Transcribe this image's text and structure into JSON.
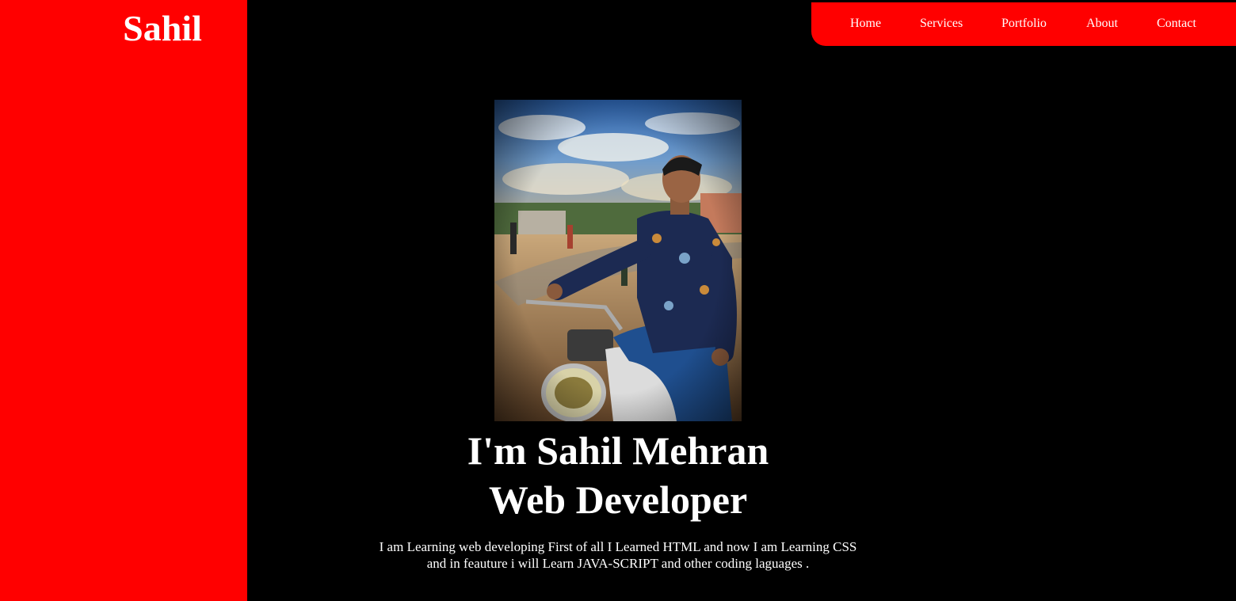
{
  "brand": {
    "logo_text": "Sahil",
    "accent_color": "#ff0000",
    "background_color": "#000000"
  },
  "nav": {
    "items": [
      {
        "label": "Home"
      },
      {
        "label": "Services"
      },
      {
        "label": "Portfolio"
      },
      {
        "label": "About"
      },
      {
        "label": "Contact"
      }
    ]
  },
  "hero": {
    "image_alt": "Photo of a young man sitting on a motorcycle",
    "title_line1": "I'm Sahil Mehran",
    "title_line2": "Web Developer",
    "description": "I am Learning web developing First of all I Learned HTML and now I am Learning CSS and in feauture i will Learn JAVA-SCRIPT and other coding laguages ."
  }
}
